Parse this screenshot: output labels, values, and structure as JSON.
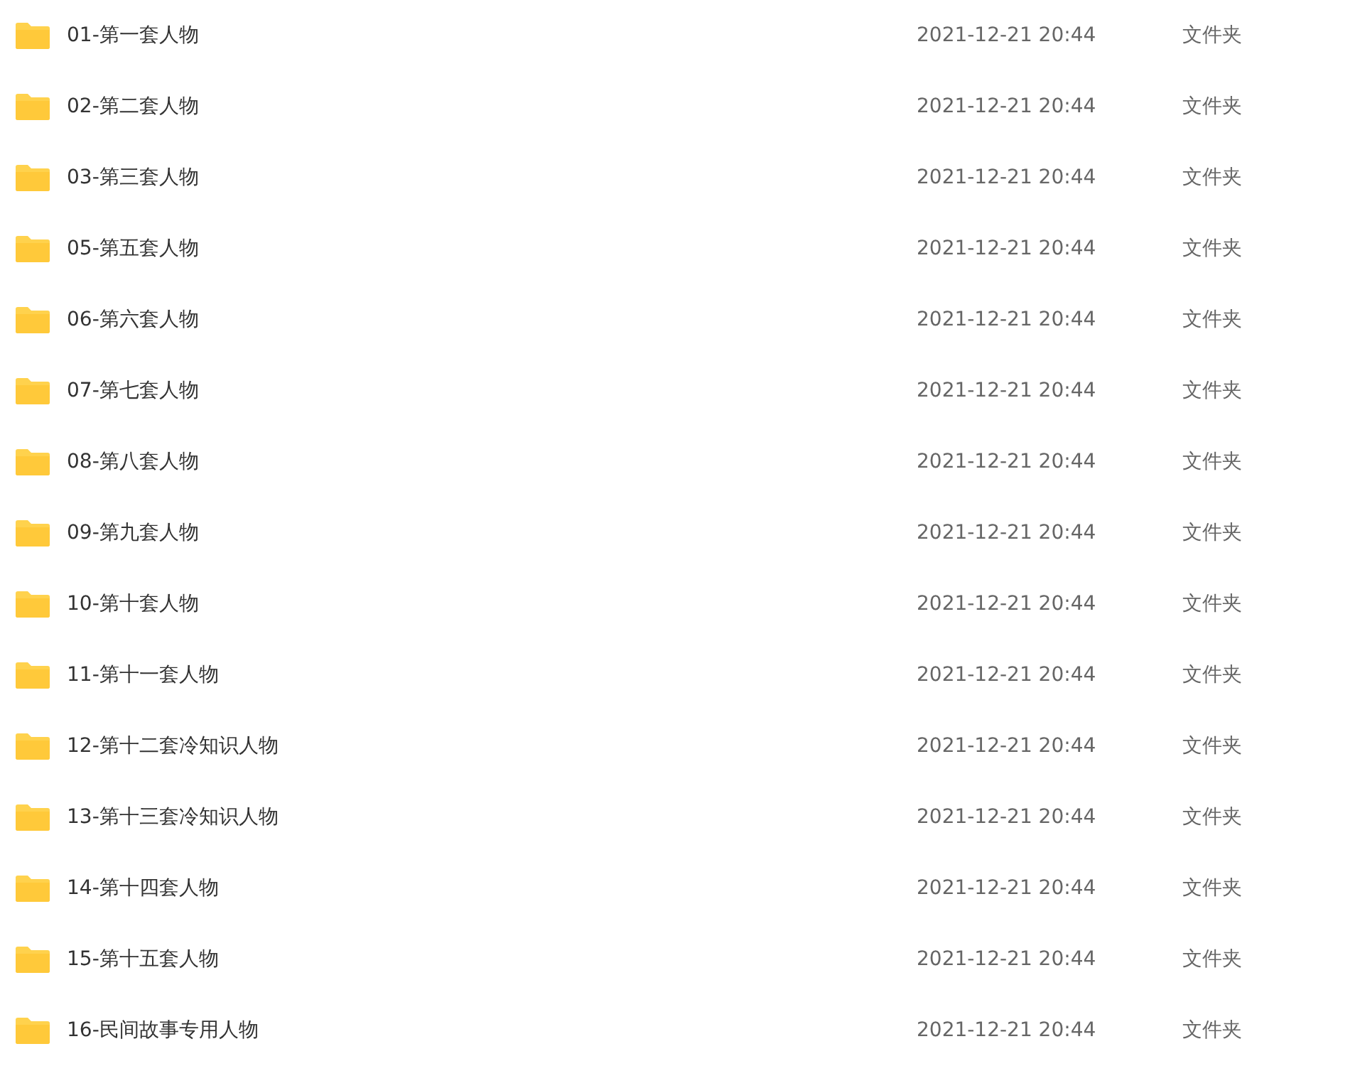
{
  "files": [
    {
      "name": "01-第一套人物",
      "modified": "2021-12-21 20:44",
      "type": "文件夹"
    },
    {
      "name": "02-第二套人物",
      "modified": "2021-12-21 20:44",
      "type": "文件夹"
    },
    {
      "name": "03-第三套人物",
      "modified": "2021-12-21 20:44",
      "type": "文件夹"
    },
    {
      "name": "05-第五套人物",
      "modified": "2021-12-21 20:44",
      "type": "文件夹"
    },
    {
      "name": "06-第六套人物",
      "modified": "2021-12-21 20:44",
      "type": "文件夹"
    },
    {
      "name": "07-第七套人物",
      "modified": "2021-12-21 20:44",
      "type": "文件夹"
    },
    {
      "name": "08-第八套人物",
      "modified": "2021-12-21 20:44",
      "type": "文件夹"
    },
    {
      "name": "09-第九套人物",
      "modified": "2021-12-21 20:44",
      "type": "文件夹"
    },
    {
      "name": "10-第十套人物",
      "modified": "2021-12-21 20:44",
      "type": "文件夹"
    },
    {
      "name": "11-第十一套人物",
      "modified": "2021-12-21 20:44",
      "type": "文件夹"
    },
    {
      "name": "12-第十二套冷知识人物",
      "modified": "2021-12-21 20:44",
      "type": "文件夹"
    },
    {
      "name": "13-第十三套冷知识人物",
      "modified": "2021-12-21 20:44",
      "type": "文件夹"
    },
    {
      "name": "14-第十四套人物",
      "modified": "2021-12-21 20:44",
      "type": "文件夹"
    },
    {
      "name": "15-第十五套人物",
      "modified": "2021-12-21 20:44",
      "type": "文件夹"
    },
    {
      "name": "16-民间故事专用人物",
      "modified": "2021-12-21 20:44",
      "type": "文件夹"
    }
  ]
}
